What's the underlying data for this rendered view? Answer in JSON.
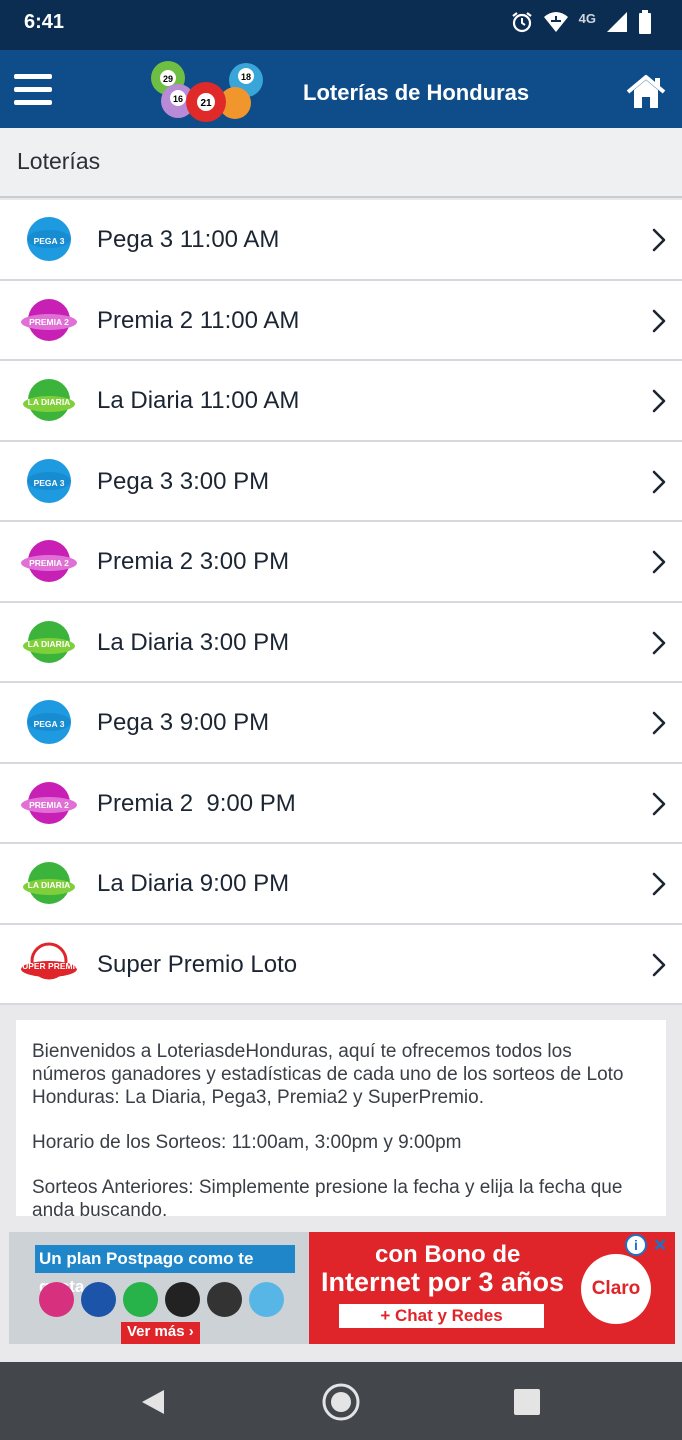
{
  "status_bar": {
    "time": "6:41",
    "network_label": "4G",
    "icons": [
      "alarm-icon",
      "wifi-icon",
      "signal-icon",
      "battery-icon"
    ]
  },
  "app_bar": {
    "title": "Loterías de Honduras",
    "menu_icon": "hamburger-menu-icon",
    "home_icon": "home-icon",
    "logo_balls": [
      "29",
      "16",
      "21",
      "18"
    ]
  },
  "section": {
    "title": "Loterías"
  },
  "lotteries": [
    {
      "label": "Pega 3 11:00 AM",
      "badge": "pega3",
      "badge_text": "PEGA 3"
    },
    {
      "label": "Premia 2 11:00 AM",
      "badge": "premia2",
      "badge_text": "PREMIA 2"
    },
    {
      "label": "La Diaria 11:00 AM",
      "badge": "diaria",
      "badge_text": "LA DIARIA"
    },
    {
      "label": "Pega 3 3:00 PM",
      "badge": "pega3",
      "badge_text": "PEGA 3"
    },
    {
      "label": "Premia 2 3:00 PM",
      "badge": "premia2",
      "badge_text": "PREMIA 2"
    },
    {
      "label": "La Diaria 3:00 PM",
      "badge": "diaria",
      "badge_text": "LA DIARIA"
    },
    {
      "label": "Pega 3 9:00 PM",
      "badge": "pega3",
      "badge_text": "PEGA 3"
    },
    {
      "label": "Premia 2  9:00 PM",
      "badge": "premia2",
      "badge_text": "PREMIA 2"
    },
    {
      "label": "La Diaria 9:00 PM",
      "badge": "diaria",
      "badge_text": "LA DIARIA"
    },
    {
      "label": "Super Premio Loto",
      "badge": "superpremio",
      "badge_text": "SUPER PREMIO"
    }
  ],
  "info": {
    "welcome": "Bienvenidos a LoteriasdeHonduras, aquí te ofrecemos todos los números ganadores y estadísticas de cada uno de los sorteos de Loto Honduras: La Diaria, Pega3, Premia2 y SuperPremio.",
    "schedule": "Horario de los Sorteos: 11:00am, 3:00pm y 9:00pm",
    "previous": "Sorteos Anteriores: Simplemente presione la fecha y elija la fecha que anda buscando."
  },
  "ad": {
    "left_headline": "Un plan Postpago como te gusta",
    "more_label": "Ver más ›",
    "headline_1": "con Bono de",
    "headline_2": "Internet por 3 años",
    "headline_3": "+ Chat y Redes ilimitadas",
    "brand": "Claro",
    "info_glyph": "i",
    "close_glyph": "×"
  },
  "colors": {
    "status_bar": "#0c2d52",
    "app_bar": "#0f4d8a",
    "pega3": "#1e9be0",
    "premia2": "#c81fb4",
    "diaria": "#3cb43c",
    "superpremio": "#e0252a"
  },
  "nav_bar": {
    "icons": [
      "back-icon",
      "home-circle-icon",
      "recents-icon"
    ]
  }
}
